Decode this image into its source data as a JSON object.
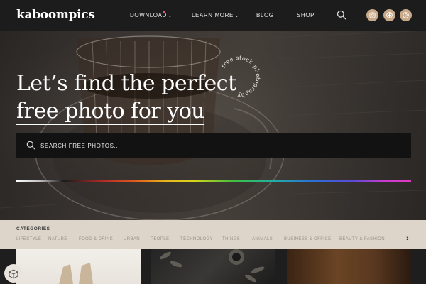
{
  "brand": {
    "logo": "kaboompics"
  },
  "nav": {
    "download": "DOWNLOAD",
    "learn_more": "LEARN MORE",
    "blog": "BLOG",
    "shop": "SHOP"
  },
  "socials": [
    "instagram-icon",
    "facebook-icon",
    "pinterest-icon"
  ],
  "colors": {
    "accent": "#c8a98a",
    "nav_bg": "#1c1c1c",
    "category_bg": "#ddd5c9"
  },
  "hero": {
    "line1": "Let’s find the perfect",
    "line2": "free photo for you",
    "badge": "free stock photography"
  },
  "search": {
    "placeholder": "SEARCH FREE PHOTOS..."
  },
  "categories": {
    "title": "CATEGORIES",
    "items": [
      "LIFESTYLE",
      "NATURE",
      "FOOD & DRINK",
      "URBAN",
      "PEOPLE",
      "TECHNOLOGY",
      "THINGS",
      "ANIMALS",
      "BUSINESS & OFFICE",
      "BEAUTY & FASHION"
    ]
  }
}
